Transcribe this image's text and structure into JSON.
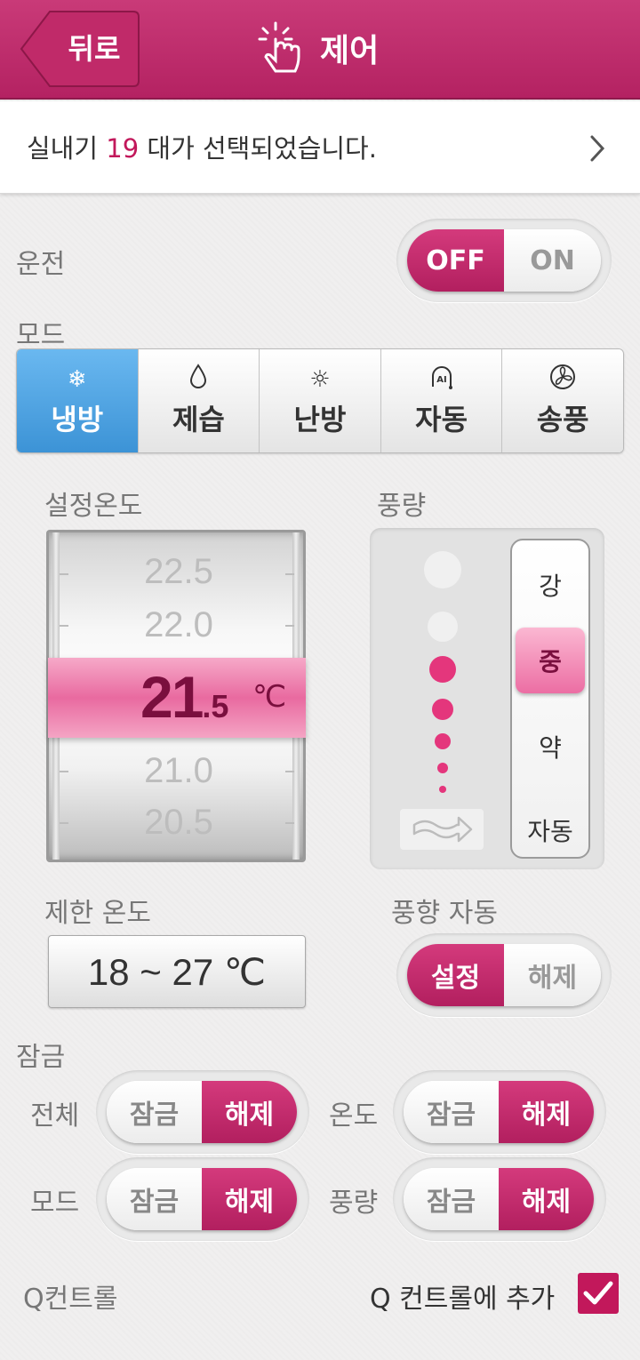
{
  "header": {
    "back_label": "뒤로",
    "title": "제어",
    "title_icon": "touch-hand-icon"
  },
  "selection": {
    "prefix": "실내기 ",
    "count": "19",
    "suffix": " 대가 선택되었습니다."
  },
  "power": {
    "label": "운전",
    "off_label": "OFF",
    "on_label": "ON",
    "selected": "OFF"
  },
  "mode": {
    "label": "모드",
    "items": [
      {
        "label": "냉방",
        "icon": "snowflake-icon",
        "glyph": "❄"
      },
      {
        "label": "제습",
        "icon": "droplet-icon",
        "glyph": "💧"
      },
      {
        "label": "난방",
        "icon": "sun-icon",
        "glyph": "☼"
      },
      {
        "label": "자동",
        "icon": "ai-icon",
        "glyph": "AI"
      },
      {
        "label": "송풍",
        "icon": "fan-icon",
        "glyph": "✿"
      }
    ],
    "selected": "냉방"
  },
  "set_temp": {
    "label": "설정온도",
    "values_above": [
      "22.5",
      "22.0"
    ],
    "current_int": "21",
    "current_dec": ".5",
    "unit": "℃",
    "values_below": [
      "21.0",
      "20.5"
    ]
  },
  "fan_speed": {
    "label": "풍량",
    "options": [
      "강",
      "중",
      "약",
      "자동"
    ],
    "selected": "중"
  },
  "limit_temp": {
    "label": "제한 온도",
    "value": "18 ~ 27 ℃"
  },
  "swing": {
    "label": "풍향 자동",
    "set_label": "설정",
    "release_label": "해제",
    "selected": "설정"
  },
  "lock": {
    "label": "잠금",
    "lock_label": "잠금",
    "release_label": "해제",
    "rows": [
      {
        "label": "전체",
        "selected": "해제"
      },
      {
        "label": "온도",
        "selected": "해제"
      },
      {
        "label": "모드",
        "selected": "해제"
      },
      {
        "label": "풍량",
        "selected": "해제"
      }
    ]
  },
  "q_control": {
    "label": "Q컨트롤",
    "add_label": "Q 컨트롤에 추가",
    "checked": true
  },
  "colors": {
    "accent": "#c2185b",
    "header": "#b42262",
    "mode_active": "#4ba3e3"
  }
}
